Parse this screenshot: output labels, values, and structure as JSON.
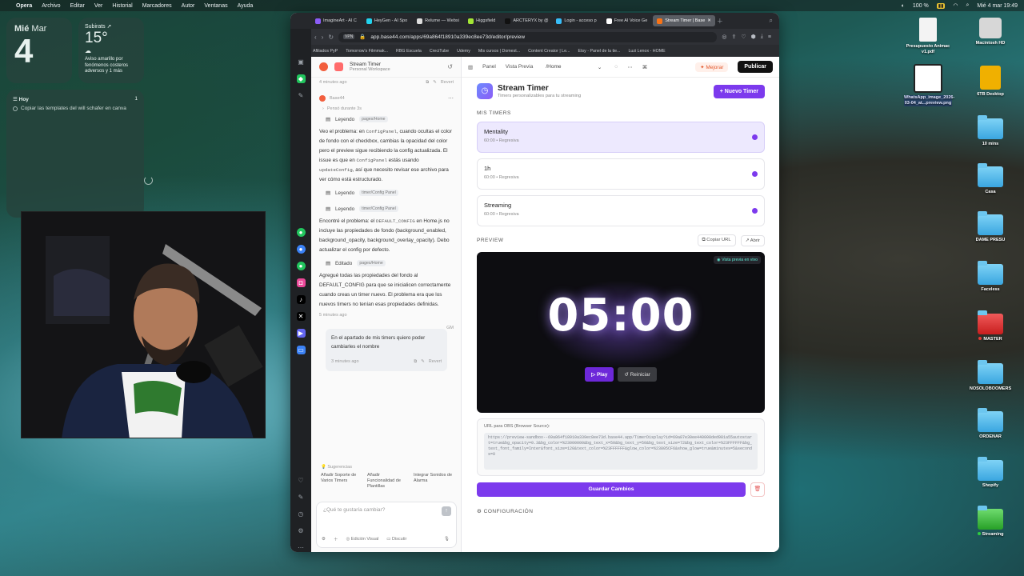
{
  "menubar": {
    "items": [
      "Opera",
      "Archivo",
      "Editar",
      "Ver",
      "Historial",
      "Marcadores",
      "Autor",
      "Ventanas",
      "Ayuda"
    ],
    "battery": "100 %",
    "clock": "Mié 4 mar 19:49"
  },
  "widgets": {
    "date_day": "Mié",
    "date_month": "Mar",
    "date_num": "4",
    "weather_city": "Subirats",
    "weather_temp": "15°",
    "weather_alert": "Aviso amarillo por fenómenos costeros adversos y 1 más",
    "reminders_title": "Hoy",
    "reminders_count": "1",
    "reminder_item": "Copiar las templates del will schafer en canva"
  },
  "desktop_icons": [
    {
      "label": "Presupuesto Animac v1.pdf",
      "kind": "doc"
    },
    {
      "label": "Macintosh HD",
      "kind": "disk"
    },
    {
      "label": "WhatsApp_image_2026-03-04_at...preview.png",
      "kind": "image"
    },
    {
      "label": "6TB Desktop",
      "kind": "drive"
    },
    {
      "label": "10 mins",
      "kind": "folder"
    },
    {
      "label": "Casa",
      "kind": "folder"
    },
    {
      "label": "DAME PRESU",
      "kind": "folder"
    },
    {
      "label": "Faceless",
      "kind": "folder"
    },
    {
      "label": "MASTER",
      "kind": "folder-red"
    },
    {
      "label": "NOSOLOBOOMERS",
      "kind": "folder"
    },
    {
      "label": "ORDENAR",
      "kind": "folder"
    },
    {
      "label": "Shopify",
      "kind": "folder"
    },
    {
      "label": "Streaming",
      "kind": "folder-green"
    }
  ],
  "browser": {
    "tabs": [
      "ImagineArt - AI C",
      "HeyGen - AI Spo",
      "Relume — Websi",
      "Higgsfield",
      "ARCTERYX by @",
      "Login - acceso p",
      "Free AI Voice Ge",
      "Stream Timer | Base"
    ],
    "active_tab_index": 7,
    "url": "app.base44.com/apps/69a864f18910a339ec8ee73d/editor/preview",
    "vpn": "VPN",
    "bookmarks": [
      "Afiliados PyP",
      "Tomorrow's Filmmak...",
      "RBG Escuela",
      "CreciTube",
      "Udemy",
      "Mis cursos | Domest...",
      "Content Creator | Le...",
      "Etsy - Panel de la tie...",
      "Luzi Lenox - HOME"
    ]
  },
  "chat": {
    "workspace_name": "Stream Timer",
    "workspace_sub": "Personal Workspace",
    "top_meta": "4 minutes ago",
    "revert": "Revert",
    "agent_name": "Base44",
    "thought": "Pensó durante 3s",
    "reading_label": "Leyendo",
    "reading_1": "pages/Home",
    "para_1a": "Veo el problema: en ",
    "code_1": "ConfigPanel",
    "para_1b": ", cuando ocultas el color de fondo con el checkbox, cambias la opacidad del color pero el preview sigue recibiendo la config actualizada. El issue es que en ",
    "code_2": "ConfigPanel",
    "para_1c": " estás usando ",
    "code_3": "updateConfig",
    "para_1d": ", así que necesito revisar ese archivo para ver cómo está estructurado.",
    "reading_2": "timer/Config Panel",
    "reading_3": "timer/Config Panel",
    "para_2a": "Encontré el problema: el ",
    "code_4": "DEFAULT_CONFIG",
    "para_2b": " en Home.js no incluye las propiedades de fondo (background_enabled, background_opacity, background_overlay_opacity). Debo actualizar el config por defecto.",
    "edited_label": "Editado",
    "edited_file": "pages/Home",
    "para_3": "Agregué todas las propiedades del fondo al DEFAULT_CONFIG para que se inicialicen correctamente cuando creas un timer nuevo. El problema era que los nuevos timers no tenían esas propiedades definidas.",
    "meta_2": "5 minutes ago",
    "user_initials": "GM",
    "user_msg": "En el apartado de mis timers quiero poder cambiarles el nombre",
    "meta_3": "3 minutes ago",
    "suggestions_title": "Sugerencias",
    "suggestions": [
      "Añadir Soporte de Varios Timers",
      "Añadir Funcionalidad de Plantillas",
      "Integrar Sonidos de Alarma"
    ],
    "input_placeholder": "¿Qué te gustaría cambiar?",
    "visual_edit": "Edición Visual",
    "discuss": "Discutir"
  },
  "topbar": {
    "panel": "Panel",
    "preview": "Vista Previa",
    "path": "/Home",
    "improve": "Mejorar",
    "publish": "Publicar"
  },
  "main": {
    "title": "Stream Timer",
    "subtitle": "Timers personalizables para tu streaming",
    "new_timer": "+ Nuevo Timer",
    "my_timers": "MIS TIMERS",
    "timers": [
      {
        "name": "Mentality",
        "detail": "60:00 • Regresiva"
      },
      {
        "name": "1h",
        "detail": "60:00 • Regresiva"
      },
      {
        "name": "Streaming",
        "detail": "60:00 • Regresiva"
      }
    ],
    "preview_label": "PREVIEW",
    "copy_url": "Copiar URL",
    "open": "Abrir",
    "live_badge": "Vista previa en vivo",
    "time": "05:00",
    "play": "Play",
    "restart": "Reiniciar",
    "obs_title": "URL para OBS (Browser Source):",
    "obs_url": "https://preview-sandbox--69a864f18910a339ec8ee73d.base44.app/TimerDisplay?id=69a87e30ee440008ded981a55autostart=true&bg_opacity=0.3&bg_color=%23000000&bg_text_x=50&bg_text_y=50&bg_text_size=72&bg_text_color=%23FFFFFF&bg_text_font_family=Inter&font_size=120&text_color=%23FFFFFF&glow_color=%23805CF6&show_glow=true&minutes=5&seconds=0",
    "save": "Guardar Cambios",
    "config": "CONFIGURACIÓN"
  },
  "colors": {
    "accent": "#7c3aed",
    "selected_bg": "#ede9fe",
    "mejorar": "#e2572b"
  }
}
